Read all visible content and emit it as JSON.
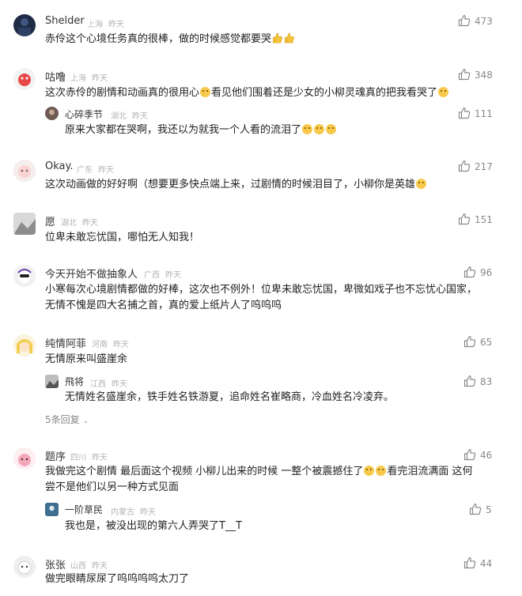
{
  "colors": {
    "accent": "#f7c84a",
    "meta_text": "#b3b3b3",
    "body_text": "#222222"
  },
  "icons": {
    "like": "thumbs-up-icon",
    "chevron": "chevron-down-icon",
    "emoji": "crying-emoji-icon"
  },
  "comments": [
    {
      "name": "Shelder",
      "location": "上海",
      "time": "昨天",
      "likes": "473",
      "text": "赤伶这个心境任务真的很棒，做的时候感觉都要哭"
    },
    {
      "name": "咕噜",
      "location": "上海",
      "time": "昨天",
      "likes": "348",
      "text_a": "这次赤伶的剧情和动画真的很用心",
      "text_b": "看见他们围着还是少女的小柳灵魂真的把我看哭了",
      "reply": {
        "name": "心碎季节",
        "location": "湖北",
        "time": "昨天",
        "likes": "111",
        "text": "原来大家都在哭啊，我还以为就我一个人看的流泪了"
      }
    },
    {
      "name": "Okay.",
      "location": "广东",
      "time": "昨天",
      "likes": "217",
      "text": "这次动画做的好好啊（想要更多快点端上来，过剧情的时候泪目了，小柳你是英雄"
    },
    {
      "name": "愿",
      "location": "湖北",
      "time": "昨天",
      "likes": "151",
      "text": "位卑未敢忘忧国，哪怕无人知我！"
    },
    {
      "name": "今天开始不做抽象人",
      "location": "广西",
      "time": "昨天",
      "likes": "96",
      "text_1": "小寒每次心境剧情都做的好棒，这次也不例外！位卑未敢忘忧国，卑微如戏子也不忘忧心国家，",
      "text_2": "无情不愧是四大名捕之首，真的爱上纸片人了呜呜呜"
    },
    {
      "name": "纯情阿菲",
      "location": "河南",
      "time": "昨天",
      "likes": "65",
      "text": "无情原来叫盛崖余",
      "reply": {
        "name": "飛将",
        "location": "江西",
        "time": "昨天",
        "likes": "83",
        "text": "无情姓名盛崖余，铁手姓名铁游夏，追命姓名崔略商，冷血姓名冷凌弃。"
      },
      "more": "5条回复"
    },
    {
      "name": "题序",
      "location": "四川",
      "time": "昨天",
      "likes": "46",
      "text_1a": "我做完这个剧情 最后面这个视频 小柳儿出来的时候 一整个被震撼住了",
      "text_1b": "看完泪流满面 这何",
      "text_2": "尝不是他们以另一种方式见面",
      "reply": {
        "name": "一阶草民",
        "location": "内蒙古",
        "time": "昨天",
        "likes": "5",
        "text": "我也是，被没出现的第六人弄哭了T__T"
      }
    },
    {
      "name": "张张",
      "location": "山西",
      "time": "昨天",
      "likes": "44",
      "text": "做完眼睛尿尿了呜呜呜呜太刀了"
    }
  ]
}
